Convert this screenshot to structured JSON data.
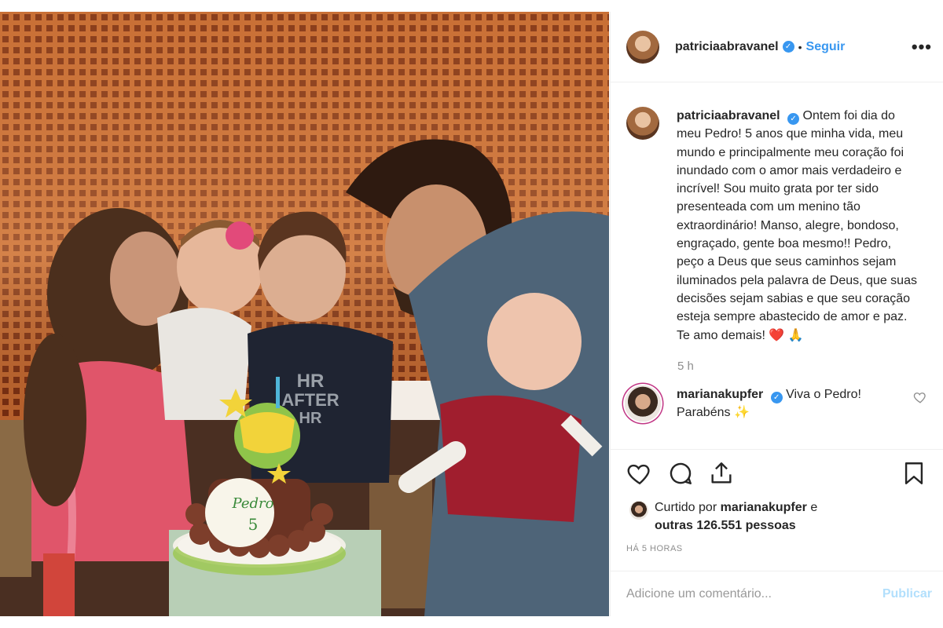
{
  "post": {
    "author": "patriciaabravanel",
    "follow_label": "Seguir",
    "separator": "•",
    "more_label": "•••",
    "verified_mark": "✓"
  },
  "caption": {
    "author": "patriciaabravanel",
    "text": "Ontem foi dia do meu Pedro! 5 anos que minha vida, meu mundo e principalmente meu coração foi inundado com o amor mais verdadeiro e incrível! Sou muito grata por ter sido presenteada com um menino tão extraordinário! Manso, alegre, bondoso, engraçado, gente boa mesmo!! Pedro, peço a Deus que seus caminhos sejam iluminados pela palavra de Deus, que suas decisões sejam sabias e que seu coração esteja sempre abastecido de amor e paz. Te amo demais! ❤️ 🙏",
    "time": "5 h"
  },
  "comment": {
    "author": "marianakupfer",
    "text": "Viva o Pedro! Parabéns ✨"
  },
  "likes": {
    "prefix": "Curtido por",
    "user": "marianakupfer",
    "joiner": "e",
    "others": "outras 126.551 pessoas"
  },
  "timestamp": "HÁ 5 HORAS",
  "comment_box": {
    "placeholder": "Adicione um comentário...",
    "publish_label": "Publicar"
  },
  "photo": {
    "cake_text_name": "Pedro",
    "cake_text_number": "5",
    "shirt_text_1": "HR",
    "shirt_text_2": "AFTER",
    "shirt_text_3": "HR"
  },
  "colors": {
    "link_blue": "#3897f0",
    "publish_disabled": "#b2dffc",
    "muted_text": "#8e8e8e",
    "border": "#efefef"
  }
}
